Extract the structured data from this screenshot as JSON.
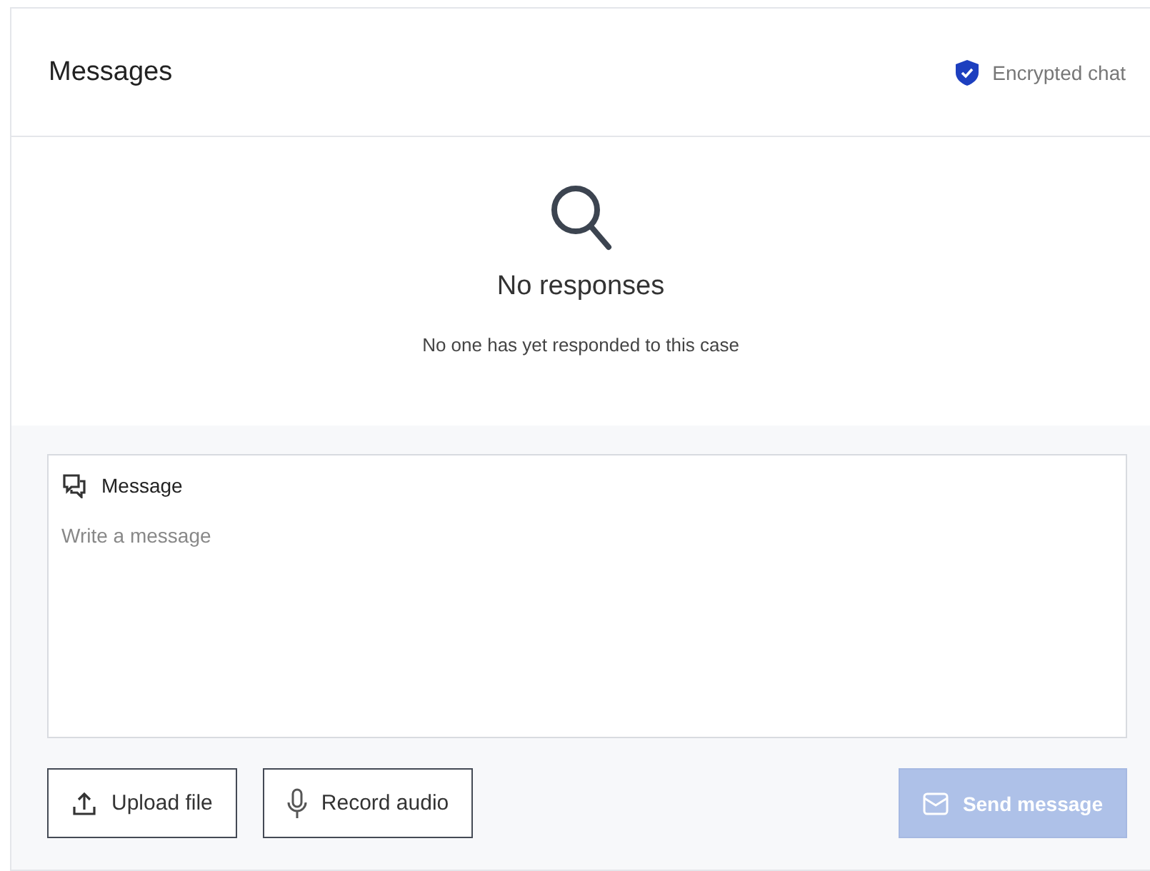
{
  "header": {
    "title": "Messages",
    "badge": "Encrypted chat"
  },
  "empty_state": {
    "title": "No responses",
    "text": "No one has yet responded to this case"
  },
  "composer": {
    "label": "Message",
    "placeholder": "Write a message"
  },
  "buttons": [
    {
      "kind": "upload",
      "label": "Upload file",
      "disabled": false
    },
    {
      "kind": "record",
      "label": "Record audio",
      "disabled": false
    },
    {
      "kind": "send",
      "label": "Send message",
      "disabled": true
    }
  ]
}
